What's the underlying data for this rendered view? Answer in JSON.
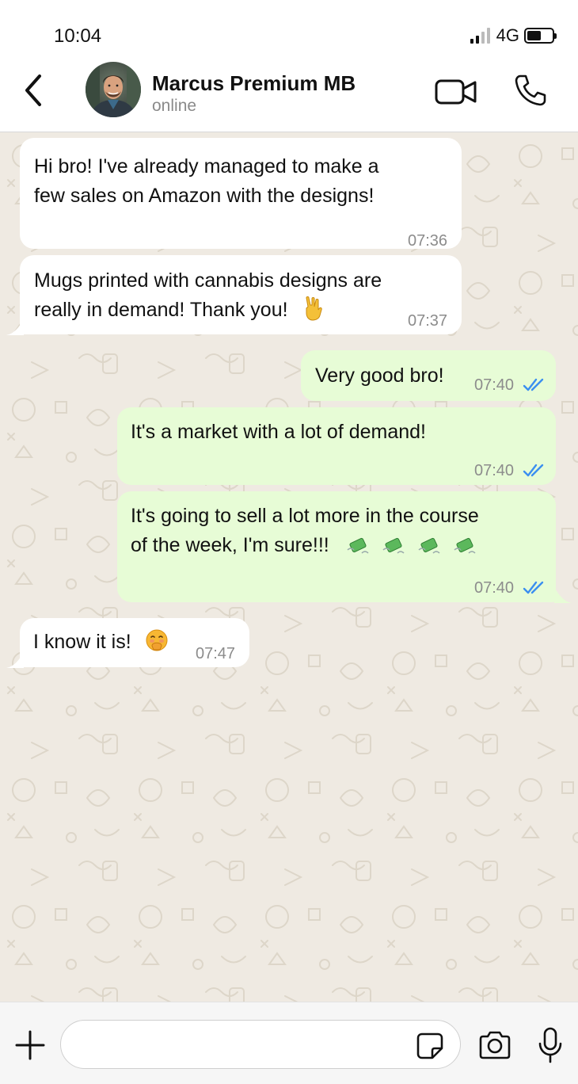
{
  "status_bar": {
    "time": "10:04",
    "network": "4G"
  },
  "header": {
    "contact_name": "Marcus Premium MB",
    "contact_status": "online",
    "icons": [
      "chevron-left-icon",
      "avatar",
      "video-camera-icon",
      "phone-icon"
    ]
  },
  "messages": [
    {
      "direction": "in",
      "text_lines": [
        "Hi bro! I've already managed to make a",
        "few sales on Amazon with the designs!"
      ],
      "time": "07:36"
    },
    {
      "direction": "in",
      "text_lines": [
        "Mugs printed with cannabis designs are",
        "really in demand! Thank you!"
      ],
      "emoji": "rock-on-hand",
      "time": "07:37"
    },
    {
      "direction": "out",
      "text": "Very good bro!",
      "time": "07:40",
      "read": true
    },
    {
      "direction": "out",
      "text": "It's a market with a lot of demand!",
      "time": "07:40",
      "read": true
    },
    {
      "direction": "out",
      "text_lines": [
        "It's going to sell a lot more in the course",
        "of the week, I'm sure!!!"
      ],
      "emoji": "money-with-wings x4",
      "time": "07:40",
      "read": true
    },
    {
      "direction": "in",
      "text": "I know it is!",
      "emoji": "hand-over-mouth-face",
      "time": "07:47"
    }
  ],
  "input_bar": {
    "placeholder": "",
    "icons": [
      "plus-icon",
      "sticker-icon",
      "camera-icon",
      "microphone-icon"
    ]
  },
  "colors": {
    "chat_background": "#efeae2",
    "incoming_bubble": "#ffffff",
    "outgoing_bubble": "#e7fcd6",
    "read_ticks": "#3b8ff0",
    "timestamp": "#8c8c8c"
  }
}
